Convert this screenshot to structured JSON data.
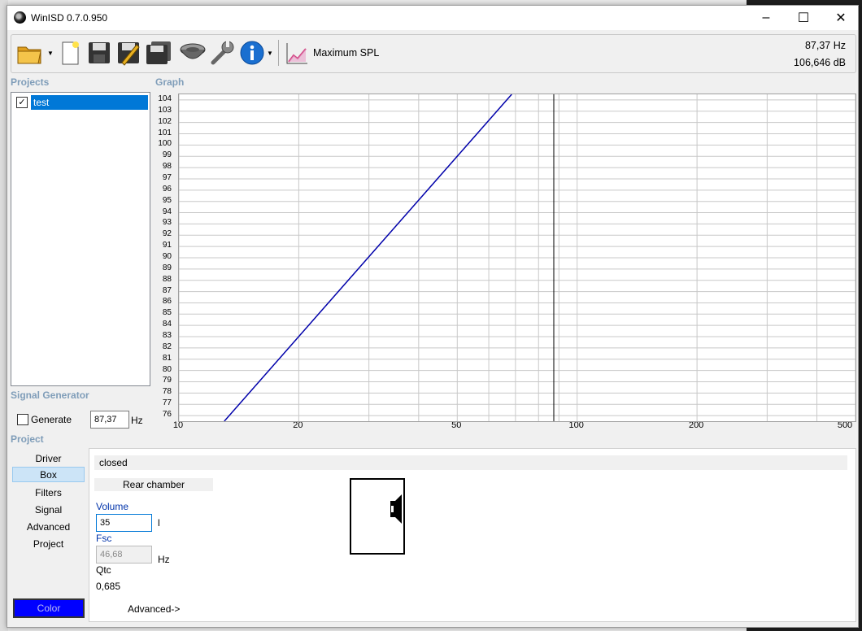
{
  "window": {
    "title": "WinISD 0.7.0.950"
  },
  "toolbar": {
    "mode_label": "Maximum SPL",
    "readout_freq": "87,37 Hz",
    "readout_db": "106,646 dB"
  },
  "projects": {
    "heading": "Projects",
    "items": [
      {
        "name": "test",
        "checked": true
      }
    ]
  },
  "graph": {
    "heading": "Graph",
    "y_ticks": [
      "104",
      "103",
      "102",
      "101",
      "100",
      "99",
      "98",
      "97",
      "96",
      "95",
      "94",
      "93",
      "92",
      "91",
      "90",
      "89",
      "88",
      "87",
      "86",
      "85",
      "84",
      "83",
      "82",
      "81",
      "80",
      "79",
      "78",
      "77",
      "76"
    ],
    "x_ticks": [
      "10",
      "20",
      "50",
      "100",
      "200",
      "500"
    ]
  },
  "chart_data": {
    "type": "line",
    "xscale": "log",
    "xlim": [
      10,
      500
    ],
    "ylim": [
      75.5,
      104.5
    ],
    "cursor_x": 87.37,
    "series": [
      {
        "x": [
          13.0,
          68.5
        ],
        "y": [
          75.5,
          104.5
        ],
        "color": "#0000aa"
      }
    ],
    "grid": true
  },
  "signal_generator": {
    "heading": "Signal Generator",
    "generate_label": "Generate",
    "frequency": "87,37",
    "unit": "Hz"
  },
  "project": {
    "heading": "Project",
    "nav": [
      "Driver",
      "Box",
      "Filters",
      "Signal",
      "Advanced",
      "Project"
    ],
    "selected": "Box",
    "color_label": "Color"
  },
  "box": {
    "type": "closed",
    "chamber_label": "Rear chamber",
    "volume_label": "Volume",
    "volume_value": "35",
    "volume_unit": "l",
    "fsc_label": "Fsc",
    "fsc_value": "46,68",
    "fsc_unit": "Hz",
    "qtc_label": "Qtc",
    "qtc_value": "0,685",
    "advanced_label": "Advanced->"
  }
}
